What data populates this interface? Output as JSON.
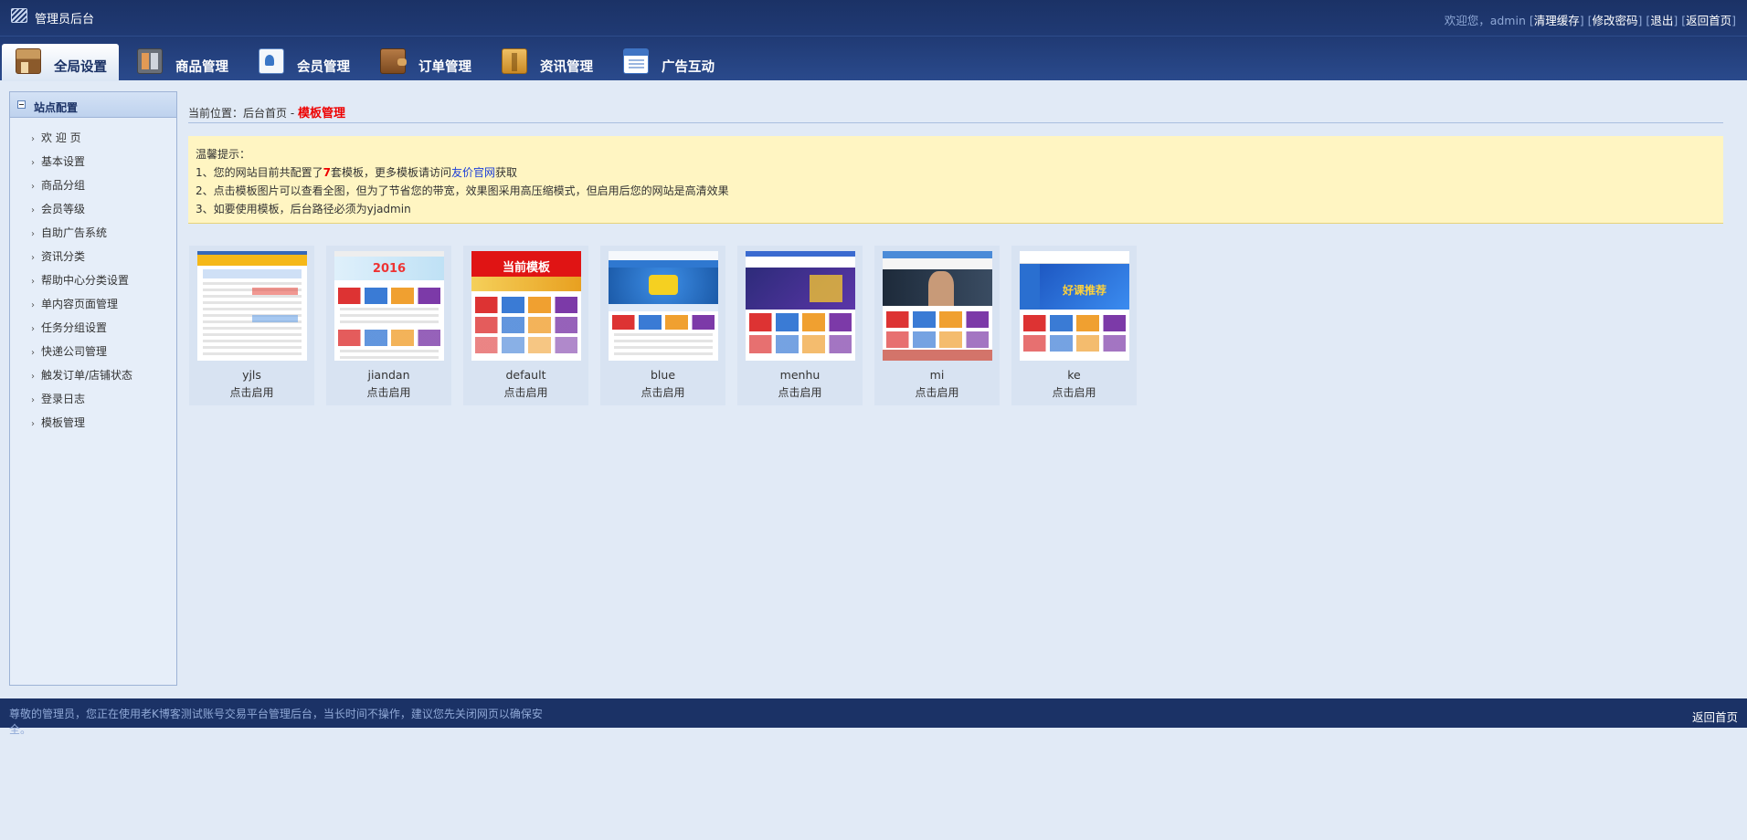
{
  "header": {
    "title": "管理员后台",
    "welcome": "欢迎您，admin",
    "links": [
      "清理缓存",
      "修改密码",
      "退出",
      "返回首页"
    ]
  },
  "nav": {
    "tabs": [
      {
        "label": "全局设置",
        "icon": "home-box-icon",
        "active": true
      },
      {
        "label": "商品管理",
        "icon": "goods-grid-icon",
        "active": false
      },
      {
        "label": "会员管理",
        "icon": "member-card-icon",
        "active": false
      },
      {
        "label": "订单管理",
        "icon": "wallet-icon",
        "active": false
      },
      {
        "label": "资讯管理",
        "icon": "news-folder-icon",
        "active": false
      },
      {
        "label": "广告互动",
        "icon": "ad-window-icon",
        "active": false
      }
    ]
  },
  "sidebar": {
    "title": "站点配置",
    "items": [
      {
        "label": "欢 迎 页"
      },
      {
        "label": "基本设置"
      },
      {
        "label": "商品分组"
      },
      {
        "label": "会员等级"
      },
      {
        "label": "自助广告系统"
      },
      {
        "label": "资讯分类"
      },
      {
        "label": "帮助中心分类设置"
      },
      {
        "label": "单内容页面管理"
      },
      {
        "label": "任务分组设置"
      },
      {
        "label": "快递公司管理"
      },
      {
        "label": "触发订单/店铺状态"
      },
      {
        "label": "登录日志"
      },
      {
        "label": "模板管理"
      }
    ]
  },
  "breadcrumb": {
    "prefix": "当前位置：后台首页 - ",
    "current": "模板管理"
  },
  "tips": {
    "title": "温馨提示：",
    "line1_a": "1、您的网站目前共配置了",
    "line1_num": "7",
    "line1_b": "套模板，更多模板请访问",
    "line1_link": "友价官网",
    "line1_c": "获取",
    "line2": "2、点击模板图片可以查看全图，但为了节省您的带宽，效果图采用高压缩模式，但启用后您的网站是高清效果",
    "line3": "3、如要使用模板，后台路径必须为yjadmin"
  },
  "templates": [
    {
      "name": "yjls",
      "action": "点击启用"
    },
    {
      "name": "jiandan",
      "action": "点击启用",
      "banner": "2016"
    },
    {
      "name": "default",
      "action": "点击启用",
      "banner": "当前模板"
    },
    {
      "name": "blue",
      "action": "点击启用"
    },
    {
      "name": "menhu",
      "action": "点击启用"
    },
    {
      "name": "mi",
      "action": "点击启用"
    },
    {
      "name": "ke",
      "action": "点击启用",
      "banner": "好课推荐"
    }
  ],
  "footer": {
    "notice": "尊敬的管理员，您正在使用老K博客测试账号交易平台管理后台，当长时间不操作，建议您先关闭网页以确保安全。",
    "home_link": "返回首页"
  }
}
